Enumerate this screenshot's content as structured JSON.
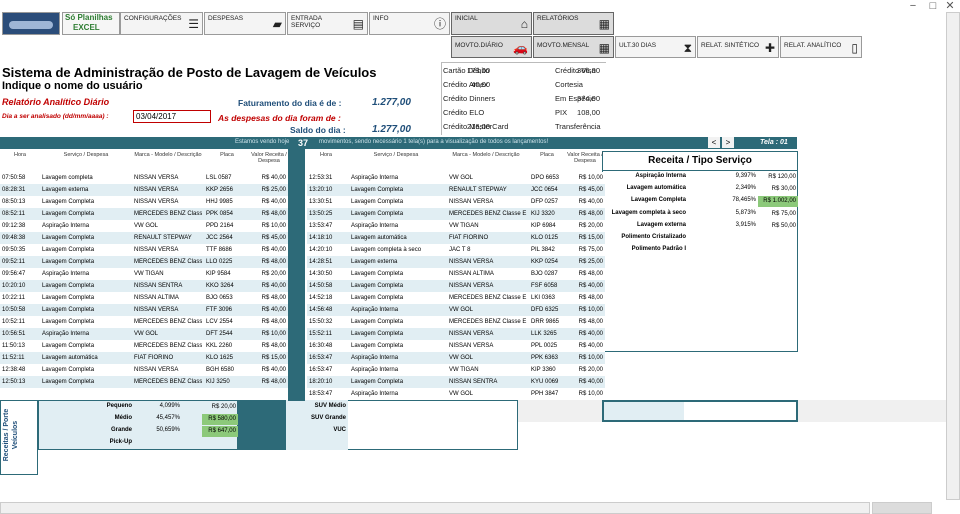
{
  "window": {
    "minimize": "−",
    "maximize": "□",
    "close": "✕"
  },
  "logo": {
    "line1": "Só Planilhas",
    "line2": "EXCEL"
  },
  "nav": [
    {
      "label": "CONFIGURAÇÕES",
      "icon": "sliders-icon",
      "glyph": "☰"
    },
    {
      "label": "DESPESAS",
      "icon": "wallet-icon",
      "glyph": "▰"
    },
    {
      "label": "ENTRADA SERVIÇO",
      "icon": "form-icon",
      "glyph": "▤"
    },
    {
      "label": "INFO",
      "icon": "info-icon",
      "glyph": "ⓘ"
    },
    {
      "label": "INICIAL",
      "icon": "home-icon",
      "glyph": "⌂"
    },
    {
      "label": "RELATÓRIOS",
      "icon": "report-icon",
      "glyph": "▦"
    }
  ],
  "nav2": [
    {
      "label": "MOVTO.DIÁRIO",
      "icon": "car-icon",
      "glyph": "🚗"
    },
    {
      "label": "MOVTO.MENSAL",
      "icon": "calendar-icon",
      "glyph": "▦"
    },
    {
      "label": "ULT.30 DIAS",
      "icon": "hourglass-icon",
      "glyph": "⧗"
    },
    {
      "label": "RELAT. SINTÉTICO",
      "icon": "puzzle-icon",
      "glyph": "✚"
    },
    {
      "label": "RELAT. ANALÍTICO",
      "icon": "document-icon",
      "glyph": "▯"
    }
  ],
  "title": "Sistema de Administração de Posto de Lavagem de Veículos",
  "user": "Indique o nome do usuário",
  "report_title": "Relatório Analítico Diário",
  "date_label": "Dia a ser analisado (dd/mm/aaaa) :",
  "date_value": "03/04/2017",
  "fat_label": "Faturamento do dia é de :",
  "fat_value": "1.277,00",
  "desp_label": "As despesas do dia foram de :",
  "saldo_label": "Saldo do dia :",
  "saldo_value": "1.277,00",
  "payments": [
    {
      "label": "Cartão Débito",
      "value": "173,00",
      "label2": "Crédito Visa",
      "value2": "366,00"
    },
    {
      "label": "Crédito Amex",
      "value": "40,00",
      "label2": "Cortesia",
      "value2": ""
    },
    {
      "label": "Crédito Dinners",
      "value": "",
      "label2": "Em Espécie",
      "value2": "374,00"
    },
    {
      "label": "Crédito ELO",
      "value": "",
      "label2": "PIX",
      "value2": "108,00"
    },
    {
      "label": "Crédito MasterCard",
      "value": "216,00",
      "label2": "Transferência",
      "value2": ""
    }
  ],
  "banner": {
    "prefix": "Estamos vendo hoje",
    "count": "37",
    "text": "movimentos, sendo necessário 1 tela(s) para a visualização de todos os lançamentos!",
    "screen": "Tela : 01",
    "prev": "<",
    "next": ">"
  },
  "headers": {
    "hora": "Hora",
    "servico": "Serviço / Despesa",
    "marca": "Marca - Modelo / Descrição",
    "placa": "Placa",
    "valor": "Valor Receita / Despesa"
  },
  "left_rows": [
    [
      "07:50:58",
      "Lavagem completa",
      "NISSAN VERSA",
      "LSL 0587",
      "R$ 40,00"
    ],
    [
      "08:28:31",
      "Lavagem externa",
      "NISSAN VERSA",
      "KKP 2656",
      "R$ 25,00"
    ],
    [
      "08:50:13",
      "Lavagem Completa",
      "NISSAN VERSA",
      "HHJ 9985",
      "R$ 40,00"
    ],
    [
      "08:52:11",
      "Lavagem Completa",
      "MERCEDES BENZ Class",
      "PPK 0854",
      "R$ 48,00"
    ],
    [
      "09:12:38",
      "Aspiração Interna",
      "VW GOL",
      "PPD 2164",
      "R$ 10,00"
    ],
    [
      "09:48:38",
      "Lavagem Completa",
      "RENAULT STEPWAY",
      "JCC 2564",
      "R$ 45,00"
    ],
    [
      "09:50:35",
      "Lavagem Completa",
      "NISSAN VERSA",
      "TTF 8686",
      "R$ 40,00"
    ],
    [
      "09:52:11",
      "Lavagem Completa",
      "MERCEDES BENZ Class",
      "LLO 0225",
      "R$ 48,00"
    ],
    [
      "09:56:47",
      "Aspiração Interna",
      "VW TIGAN",
      "KIP 9584",
      "R$ 20,00"
    ],
    [
      "10:20:10",
      "Lavagem Completa",
      "NISSAN SENTRA",
      "KKO 3264",
      "R$ 40,00"
    ],
    [
      "10:22:11",
      "Lavagem Completa",
      "NISSAN ALTIMA",
      "BJO 0653",
      "R$ 48,00"
    ],
    [
      "10:50:58",
      "Lavagem Completa",
      "NISSAN VERSA",
      "FTF 3096",
      "R$ 40,00"
    ],
    [
      "10:52:11",
      "Lavagem Completa",
      "MERCEDES BENZ Class",
      "LCV 2554",
      "R$ 48,00"
    ],
    [
      "10:56:51",
      "Aspiração Interna",
      "VW GOL",
      "DFT 2544",
      "R$ 10,00"
    ],
    [
      "11:50:13",
      "Lavagem Completa",
      "MERCEDES BENZ Class",
      "KKL 2260",
      "R$ 48,00"
    ],
    [
      "11:52:11",
      "Lavagem automática",
      "FIAT FIORINO",
      "KLO 1625",
      "R$ 15,00"
    ],
    [
      "12:38:48",
      "Lavagem Completa",
      "NISSAN VERSA",
      "BGH 6580",
      "R$ 40,00"
    ],
    [
      "12:50:13",
      "Lavagem Completa",
      "MERCEDES BENZ Class",
      "KIJ 3250",
      "R$ 48,00"
    ]
  ],
  "right_rows": [
    [
      "12:53:31",
      "Aspiração Interna",
      "VW GOL",
      "DPO 6653",
      "R$ 10,00"
    ],
    [
      "13:20:10",
      "Lavagem Completa",
      "RENAULT STEPWAY",
      "JCC 0654",
      "R$ 45,00"
    ],
    [
      "13:30:51",
      "Lavagem Completa",
      "NISSAN VERSA",
      "DFP 0257",
      "R$ 40,00"
    ],
    [
      "13:50:25",
      "Lavagem Completa",
      "MERCEDES BENZ Classe E",
      "KIJ 3320",
      "R$ 48,00"
    ],
    [
      "13:53:47",
      "Aspiração Interna",
      "VW TIGAN",
      "KIP 6984",
      "R$ 20,00"
    ],
    [
      "14:18:10",
      "Lavagem automática",
      "FIAT FIORINO",
      "KLO 0125",
      "R$ 15,00"
    ],
    [
      "14:20:10",
      "Lavagem completa à seco",
      "JAC T 8",
      "PIL 3842",
      "R$ 75,00"
    ],
    [
      "14:28:51",
      "Lavagem externa",
      "NISSAN VERSA",
      "KKP 0254",
      "R$ 25,00"
    ],
    [
      "14:30:50",
      "Lavagem Completa",
      "NISSAN ALTIMA",
      "BJO 0287",
      "R$ 48,00"
    ],
    [
      "14:50:58",
      "Lavagem Completa",
      "NISSAN VERSA",
      "FSF 6058",
      "R$ 40,00"
    ],
    [
      "14:52:18",
      "Lavagem Completa",
      "MERCEDES BENZ Classe E",
      "LKI 0363",
      "R$ 48,00"
    ],
    [
      "14:56:48",
      "Aspiração Interna",
      "VW GOL",
      "DFD 6325",
      "R$ 10,00"
    ],
    [
      "15:50:32",
      "Lavagem Completa",
      "MERCEDES BENZ Classe E",
      "DRR 9865",
      "R$ 48,00"
    ],
    [
      "15:52:11",
      "Lavagem Completa",
      "NISSAN VERSA",
      "LLK 3265",
      "R$ 40,00"
    ],
    [
      "16:30:48",
      "Lavagem Completa",
      "NISSAN VERSA",
      "PPL 0025",
      "R$ 40,00"
    ],
    [
      "16:53:47",
      "Aspiração Interna",
      "VW GOL",
      "PPK 6363",
      "R$ 10,00"
    ],
    [
      "16:53:47",
      "Aspiração Interna",
      "VW TIGAN",
      "KIP 3360",
      "R$ 20,00"
    ],
    [
      "18:20:10",
      "Lavagem Completa",
      "NISSAN SENTRA",
      "KYU 0069",
      "R$ 40,00"
    ],
    [
      "18:53:47",
      "Aspiração Interna",
      "VW GOL",
      "PPH 3847",
      "R$ 10,00"
    ]
  ],
  "receita": {
    "title": "Receita / Tipo Serviço",
    "rows": [
      [
        "Aspiração Interna",
        "9,397%",
        "R$ 120,00"
      ],
      [
        "Lavagem automática",
        "2,349%",
        "R$ 30,00"
      ],
      [
        "Lavagem Completa",
        "78,465%",
        "R$ 1.002,00"
      ],
      [
        "Lavagem completa à seco",
        "5,873%",
        "R$ 75,00"
      ],
      [
        "Lavagem externa",
        "3,915%",
        "R$ 50,00"
      ],
      [
        "Polimento Cristalizado",
        "",
        ""
      ],
      [
        "Polimento Padrão I",
        "",
        ""
      ]
    ]
  },
  "porte": {
    "side": "Receitas / Porte Veículos",
    "rows": [
      [
        "Pequeno",
        "4,099%",
        "R$ 20,00"
      ],
      [
        "Médio",
        "45,457%",
        "R$ 580,00"
      ],
      [
        "Grande",
        "50,659%",
        "R$ 647,00"
      ],
      [
        "Pick-Up",
        "",
        ""
      ]
    ],
    "rows2": [
      "SUV Médio",
      "SUV Grande",
      "VUC"
    ]
  },
  "colors": {
    "teal": "#2d6a78",
    "green": "#8cc97a",
    "band": "#e1eef3",
    "red": "#c00000",
    "navy": "#1f4e79"
  }
}
